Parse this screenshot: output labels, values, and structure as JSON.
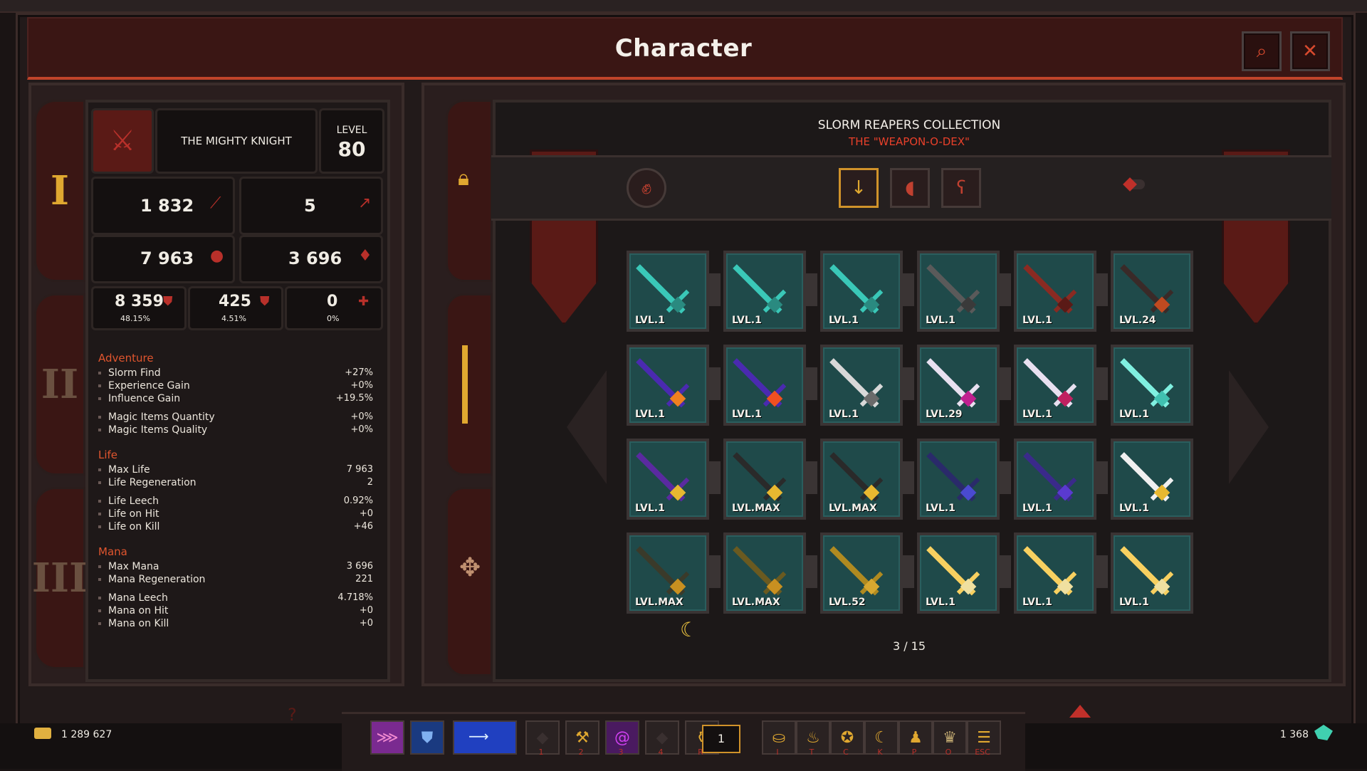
{
  "window": {
    "title": "Character",
    "search_icon": "magnifier-icon",
    "close_icon": "close-x-icon"
  },
  "character": {
    "name": "THE MIGHTY KNIGHT",
    "level_label": "LEVEL",
    "level": "80",
    "tiers": [
      "I",
      "II",
      "III"
    ]
  },
  "stats_top": {
    "damage": "1 832",
    "attack_speed": "5",
    "life": "7 963",
    "mana": "3 696",
    "armor": "8 359",
    "armor_pct": "48.15%",
    "resist": "425",
    "resist_pct": "4.51%",
    "dodge": "0",
    "dodge_pct": "0%"
  },
  "sections": {
    "adventure": {
      "title": "Adventure",
      "rows": [
        {
          "label": "Slorm Find",
          "value": "+27%"
        },
        {
          "label": "Experience Gain",
          "value": "+0%"
        },
        {
          "label": "Influence Gain",
          "value": "+19.5%"
        },
        {
          "label": "Magic Items Quantity",
          "value": "+0%"
        },
        {
          "label": "Magic Items Quality",
          "value": "+0%"
        }
      ]
    },
    "life": {
      "title": "Life",
      "rows": [
        {
          "label": "Max Life",
          "value": "7 963"
        },
        {
          "label": "Life Regeneration",
          "value": "2"
        },
        {
          "label": "Life Leech",
          "value": "0.92%"
        },
        {
          "label": "Life on Hit",
          "value": "+0"
        },
        {
          "label": "Life on Kill",
          "value": "+46"
        }
      ]
    },
    "mana": {
      "title": "Mana",
      "rows": [
        {
          "label": "Max Mana",
          "value": "3 696"
        },
        {
          "label": "Mana Regeneration",
          "value": "221"
        },
        {
          "label": "Mana Leech",
          "value": "4.718%"
        },
        {
          "label": "Mana on Hit",
          "value": "+0"
        },
        {
          "label": "Mana on Kill",
          "value": "+0"
        }
      ]
    }
  },
  "collection": {
    "title": "SLORM REAPERS COLLECTION",
    "subtitle": "THE \"WEAPON-O-DEX\"",
    "page": "3 / 15",
    "weapons": [
      {
        "lvl": "LVL.1",
        "blade": "#3ac8b8",
        "gem": "#2a8a80"
      },
      {
        "lvl": "LVL.1",
        "blade": "#3ac8b8",
        "gem": "#2a8a80"
      },
      {
        "lvl": "LVL.1",
        "blade": "#3ac8b8",
        "gem": "#2a8a80"
      },
      {
        "lvl": "LVL.1",
        "blade": "#5a5a5a",
        "gem": "#3a3a3a"
      },
      {
        "lvl": "LVL.1",
        "blade": "#8a2a22",
        "gem": "#5a1a16"
      },
      {
        "lvl": "LVL.24",
        "blade": "#3a2a28",
        "gem": "#c04a20"
      },
      {
        "lvl": "LVL.1",
        "blade": "#4a2ab0",
        "gem": "#f08020"
      },
      {
        "lvl": "LVL.1",
        "blade": "#4a2ab0",
        "gem": "#f05020"
      },
      {
        "lvl": "LVL.1",
        "blade": "#d8d8d8",
        "gem": "#6a6a6a"
      },
      {
        "lvl": "LVL.29",
        "blade": "#e8e0f0",
        "gem": "#c02090"
      },
      {
        "lvl": "LVL.1",
        "blade": "#e8e0f0",
        "gem": "#c02060"
      },
      {
        "lvl": "LVL.1",
        "blade": "#80f0e0",
        "gem": "#40c0b0"
      },
      {
        "lvl": "LVL.1",
        "blade": "#5a2aa0",
        "gem": "#e8b830"
      },
      {
        "lvl": "LVL.MAX",
        "blade": "#2a2a2a",
        "gem": "#e8b830"
      },
      {
        "lvl": "LVL.MAX",
        "blade": "#2a2a2a",
        "gem": "#e8b830"
      },
      {
        "lvl": "LVL.1",
        "blade": "#2a2a6a",
        "gem": "#4a4ad0"
      },
      {
        "lvl": "LVL.1",
        "blade": "#3a2a8a",
        "gem": "#5a3ad0"
      },
      {
        "lvl": "LVL.1",
        "blade": "#f0f0f0",
        "gem": "#e8b830"
      },
      {
        "lvl": "LVL.MAX",
        "blade": "#3a3a2a",
        "gem": "#c89020"
      },
      {
        "lvl": "LVL.MAX",
        "blade": "#6a5a20",
        "gem": "#c89020"
      },
      {
        "lvl": "LVL.52",
        "blade": "#b08a20",
        "gem": "#d8a830"
      },
      {
        "lvl": "LVL.1",
        "blade": "#f8d060",
        "gem": "#f0e0a0"
      },
      {
        "lvl": "LVL.1",
        "blade": "#f8d060",
        "gem": "#f0e0a0"
      },
      {
        "lvl": "LVL.1",
        "blade": "#f8d060",
        "gem": "#f0e0a0"
      }
    ]
  },
  "bottom": {
    "gold": "1 289 627",
    "shards": "1 368",
    "quickslot": "1",
    "hotkey_labels": [
      "1",
      "2",
      "3",
      "4",
      "R",
      "I",
      "T",
      "C",
      "K",
      "P",
      "O",
      "ESC"
    ]
  },
  "colors": {
    "accent": "#c0442a",
    "title_bar": "#3a1614",
    "selected": "#d0922a"
  }
}
